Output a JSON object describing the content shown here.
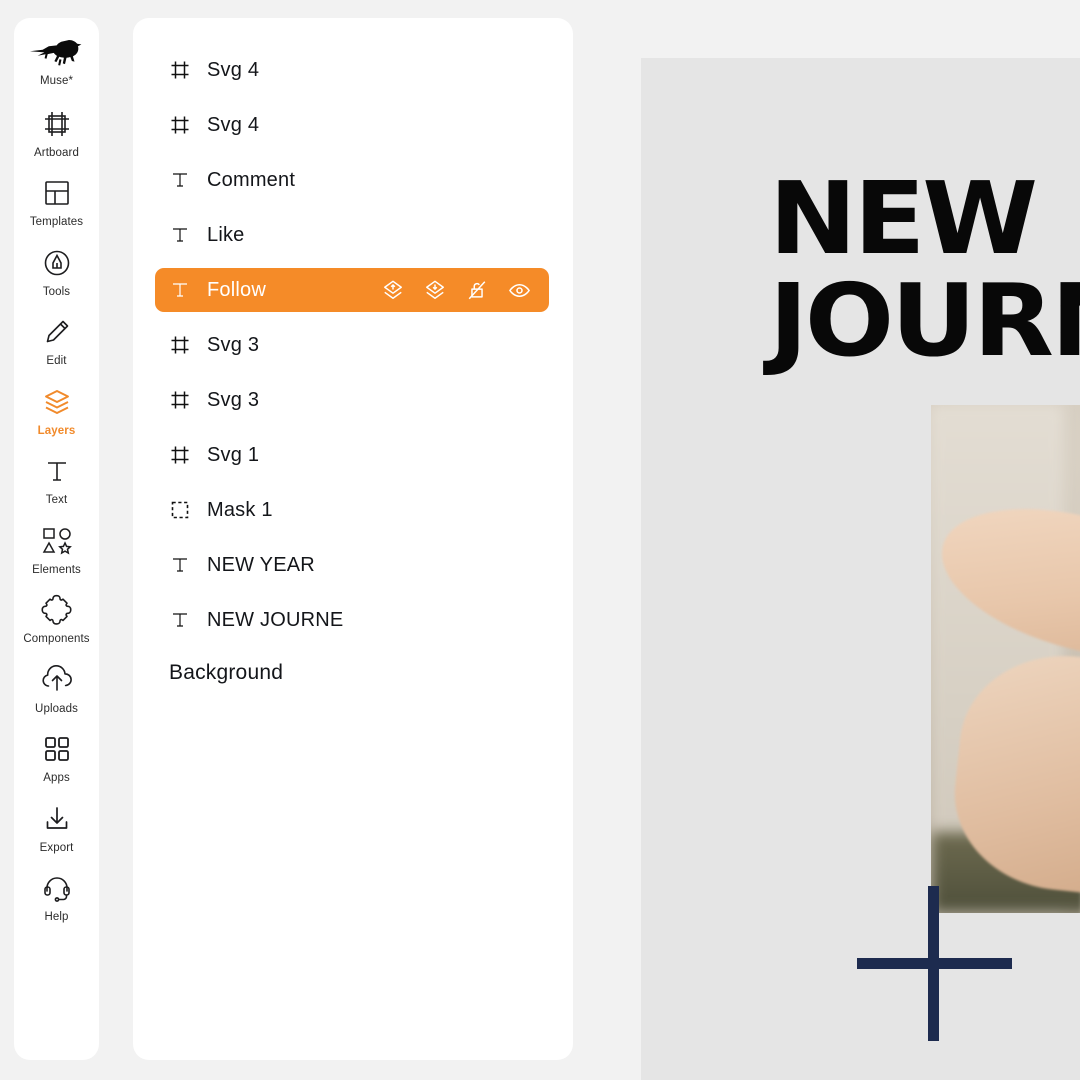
{
  "app": {
    "brand_name": "Muse*",
    "brand_icon": "dinosaur-logo",
    "background_color": "#f2f2f2",
    "accent_color": "#f58b28",
    "panel_color": "#ffffff"
  },
  "sidebar": {
    "items": [
      {
        "label": "Artboard",
        "icon": "artboard-icon",
        "active": false
      },
      {
        "label": "Templates",
        "icon": "templates-icon",
        "active": false
      },
      {
        "label": "Tools",
        "icon": "tools-icon",
        "active": false
      },
      {
        "label": "Edit",
        "icon": "edit-pencil-icon",
        "active": false
      },
      {
        "label": "Layers",
        "icon": "layers-icon",
        "active": true
      },
      {
        "label": "Text",
        "icon": "text-icon",
        "active": false
      },
      {
        "label": "Elements",
        "icon": "elements-icon",
        "active": false
      },
      {
        "label": "Components",
        "icon": "components-icon",
        "active": false
      },
      {
        "label": "Uploads",
        "icon": "uploads-icon",
        "active": false
      },
      {
        "label": "Apps",
        "icon": "apps-icon",
        "active": false
      },
      {
        "label": "Export",
        "icon": "export-icon",
        "active": false
      },
      {
        "label": "Help",
        "icon": "help-headset-icon",
        "active": false
      }
    ]
  },
  "layers_panel": {
    "rows": [
      {
        "name": "Svg 4",
        "icon": "frame-icon",
        "selected": false
      },
      {
        "name": "Svg 4",
        "icon": "frame-icon",
        "selected": false
      },
      {
        "name": "Comment",
        "icon": "text-layer-icon",
        "selected": false
      },
      {
        "name": "Like",
        "icon": "text-layer-icon",
        "selected": false
      },
      {
        "name": "Follow",
        "icon": "text-layer-icon",
        "selected": true
      },
      {
        "name": "Svg 3",
        "icon": "frame-icon",
        "selected": false
      },
      {
        "name": "Svg 3",
        "icon": "frame-icon",
        "selected": false
      },
      {
        "name": "Svg 1",
        "icon": "frame-icon",
        "selected": false
      },
      {
        "name": "Mask 1",
        "icon": "mask-icon",
        "selected": false
      },
      {
        "name": "NEW YEAR",
        "icon": "text-layer-icon",
        "selected": false
      },
      {
        "name": "NEW JOURNE",
        "icon": "text-layer-icon",
        "selected": false
      }
    ],
    "background_row": {
      "name": "Background",
      "icon": "none"
    },
    "selected_row_actions": [
      {
        "icon": "bring-forward-icon"
      },
      {
        "icon": "send-backward-icon"
      },
      {
        "icon": "unlock-icon"
      },
      {
        "icon": "visibility-eye-icon"
      }
    ]
  },
  "canvas": {
    "headline_line1": "NEW",
    "headline_line2": "JOURNE",
    "photo_alt": "hands-meditation-mudra-photo",
    "plus_shape": "plus-cross-graphic",
    "plus_color": "#1d2b4f",
    "artboard_color": "#e5e5e5"
  }
}
